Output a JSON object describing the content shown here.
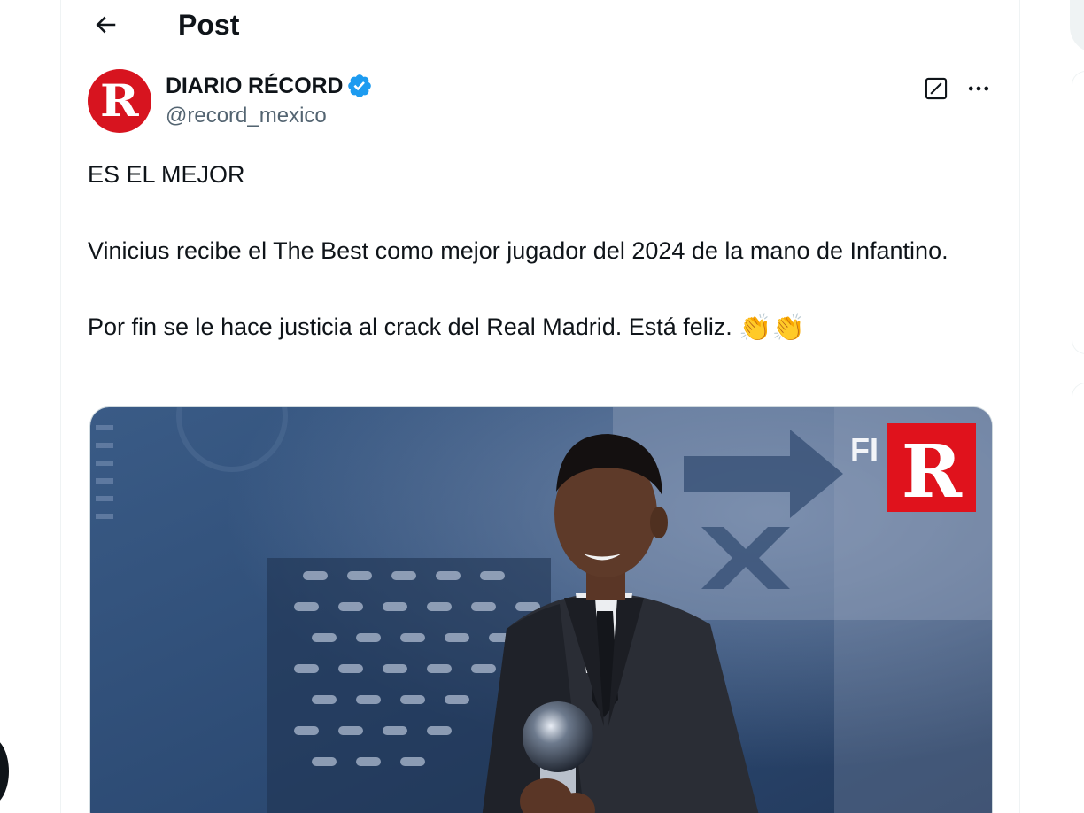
{
  "header": {
    "title": "Post",
    "back_icon": "arrow-left-icon"
  },
  "author": {
    "display_name": "DIARIO RÉCORD",
    "handle": "@record_mexico",
    "verified": true,
    "avatar_letter": "R",
    "avatar_color": "#d7141f",
    "verified_color": "#1d9bf0"
  },
  "actions": {
    "grok_icon": "grok-icon",
    "more_icon": "more-horizontal-icon"
  },
  "tweet": {
    "line1": "ES EL MEJOR",
    "line2": "Vinicius recibe el The Best como mejor jugador del 2024 de la mano de Infantino.",
    "line3": "Por fin se le hace justicia al crack del Real Madrid. Está feliz.",
    "emoji": "👏👏"
  },
  "media": {
    "watermark_letters": "FI",
    "logo_letter": "R",
    "logo_color": "#e0121c",
    "background_color": "#2e4a70"
  },
  "colors": {
    "text": "#0f1419",
    "secondary": "#536471",
    "border": "#eff3f4"
  }
}
